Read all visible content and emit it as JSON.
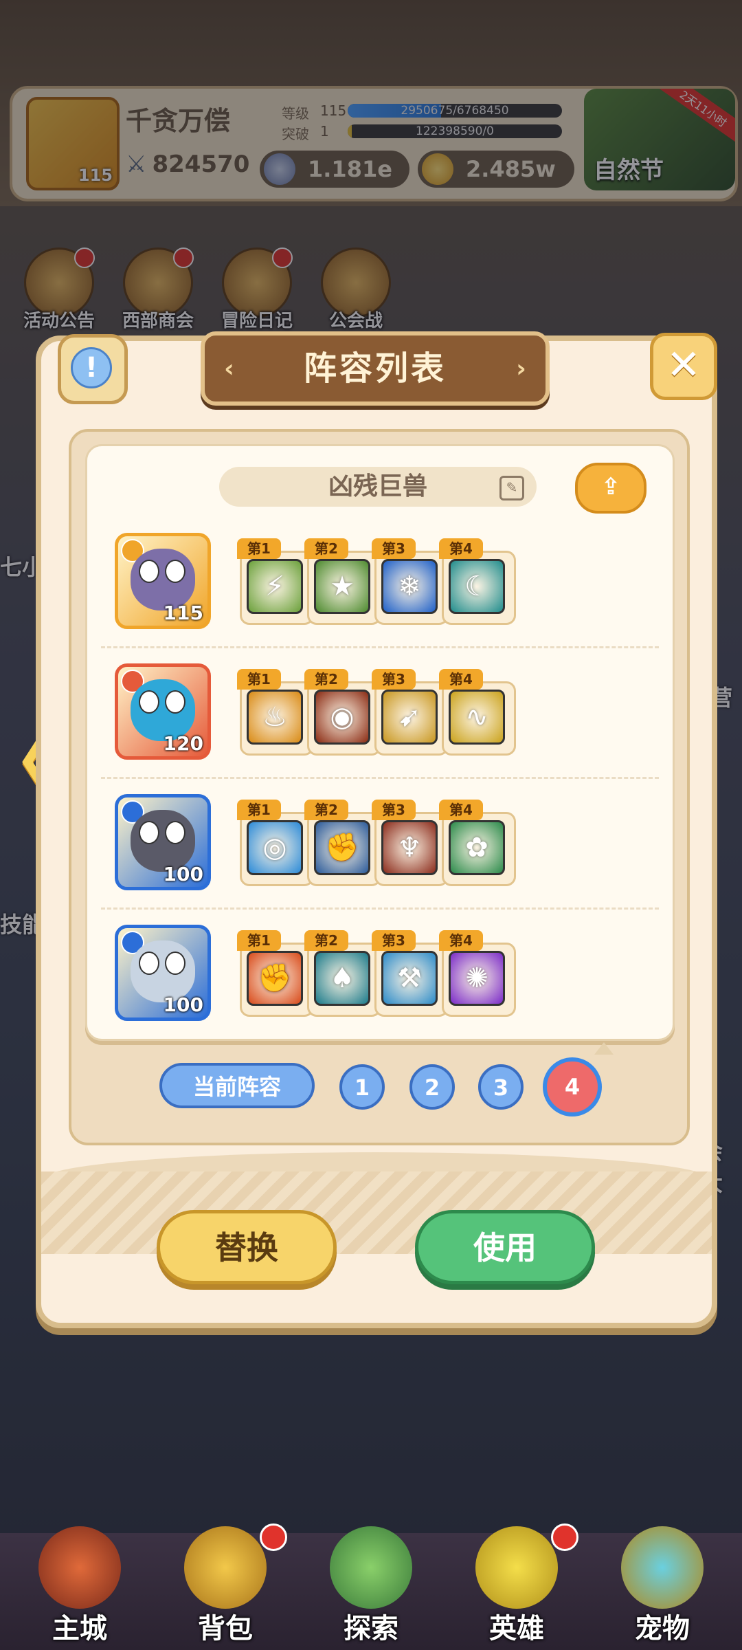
{
  "header": {
    "player_name": "千贪万偿",
    "player_level": "115",
    "power": "824570",
    "level_label": "等级",
    "level_value": "115",
    "level_exp": "2950675/6768450",
    "level_progress": 0.436,
    "break_label": "突破",
    "break_value": "1",
    "break_exp": "122398590/0",
    "currency_silver": "1.181e",
    "currency_gold": "2.485w",
    "event_name": "自然节",
    "event_timer": "2天11小时"
  },
  "shortcuts": [
    {
      "label": "活动公告",
      "icon": "announcement-icon"
    },
    {
      "label": "西部商会",
      "icon": "merchant-icon"
    },
    {
      "label": "冒险日记",
      "icon": "diary-icon"
    },
    {
      "label": "公会战",
      "icon": "guild-war-icon"
    }
  ],
  "modal": {
    "title": "阵容列表",
    "lineup_name": "凶残巨兽",
    "current_lineup_label": "当前阵容",
    "pages": [
      "1",
      "2",
      "3",
      "4"
    ],
    "active_page": "4",
    "replace_label": "替换",
    "use_label": "使用"
  },
  "heroes": [
    {
      "level": "115",
      "frame": "#f0a52a",
      "skin": "#7d6fa8",
      "skills": [
        {
          "tag": "第1",
          "bg": "#6aa03a",
          "icon": "lightning-spear-icon"
        },
        {
          "tag": "第2",
          "bg": "#4c8a2e",
          "icon": "star-shield-icon"
        },
        {
          "tag": "第3",
          "bg": "#1d5fc8",
          "icon": "ice-blade-icon"
        },
        {
          "tag": "第4",
          "bg": "#1f8c8c",
          "icon": "shadow-beast-icon"
        }
      ]
    },
    {
      "level": "120",
      "frame": "#e55a3a",
      "skin": "#2fa8d8",
      "skills": [
        {
          "tag": "第1",
          "bg": "#d98a14",
          "icon": "fire-dragon-icon"
        },
        {
          "tag": "第2",
          "bg": "#8a2a12",
          "icon": "dragon-eye-icon"
        },
        {
          "tag": "第3",
          "bg": "#c8961e",
          "icon": "charge-icon"
        },
        {
          "tag": "第4",
          "bg": "#caa21a",
          "icon": "serpent-strike-icon"
        }
      ]
    },
    {
      "level": "100",
      "frame": "#2c6ed8",
      "skin": "#5a5a68",
      "skills": [
        {
          "tag": "第1",
          "bg": "#2a8ad8",
          "icon": "wind-orb-icon"
        },
        {
          "tag": "第2",
          "bg": "#2a5a9a",
          "icon": "stone-fist-icon"
        },
        {
          "tag": "第3",
          "bg": "#8a2a1a",
          "icon": "flame-totem-icon"
        },
        {
          "tag": "第4",
          "bg": "#2a8a4a",
          "icon": "healing-flower-icon"
        }
      ]
    },
    {
      "level": "100",
      "frame": "#2c6ed8",
      "skin": "#c8d4e2",
      "skills": [
        {
          "tag": "第1",
          "bg": "#d84a1a",
          "icon": "fist-icon"
        },
        {
          "tag": "第2",
          "bg": "#1a7a8a",
          "icon": "mask-icon"
        },
        {
          "tag": "第3",
          "bg": "#2a8ac8",
          "icon": "frost-hammer-icon"
        },
        {
          "tag": "第4",
          "bg": "#7a2ac8",
          "icon": "arcane-sigil-icon"
        }
      ]
    }
  ],
  "side_fragments": {
    "left_1": "七小",
    "left_2": "技能",
    "right_1": "营",
    "right_2": "会大"
  },
  "bottom_nav": [
    {
      "label": "主城",
      "icon": "castle-icon"
    },
    {
      "label": "背包",
      "icon": "backpack-icon"
    },
    {
      "label": "探索",
      "icon": "map-icon"
    },
    {
      "label": "英雄",
      "icon": "hero-icon"
    },
    {
      "label": "宠物",
      "icon": "pet-icon"
    }
  ]
}
